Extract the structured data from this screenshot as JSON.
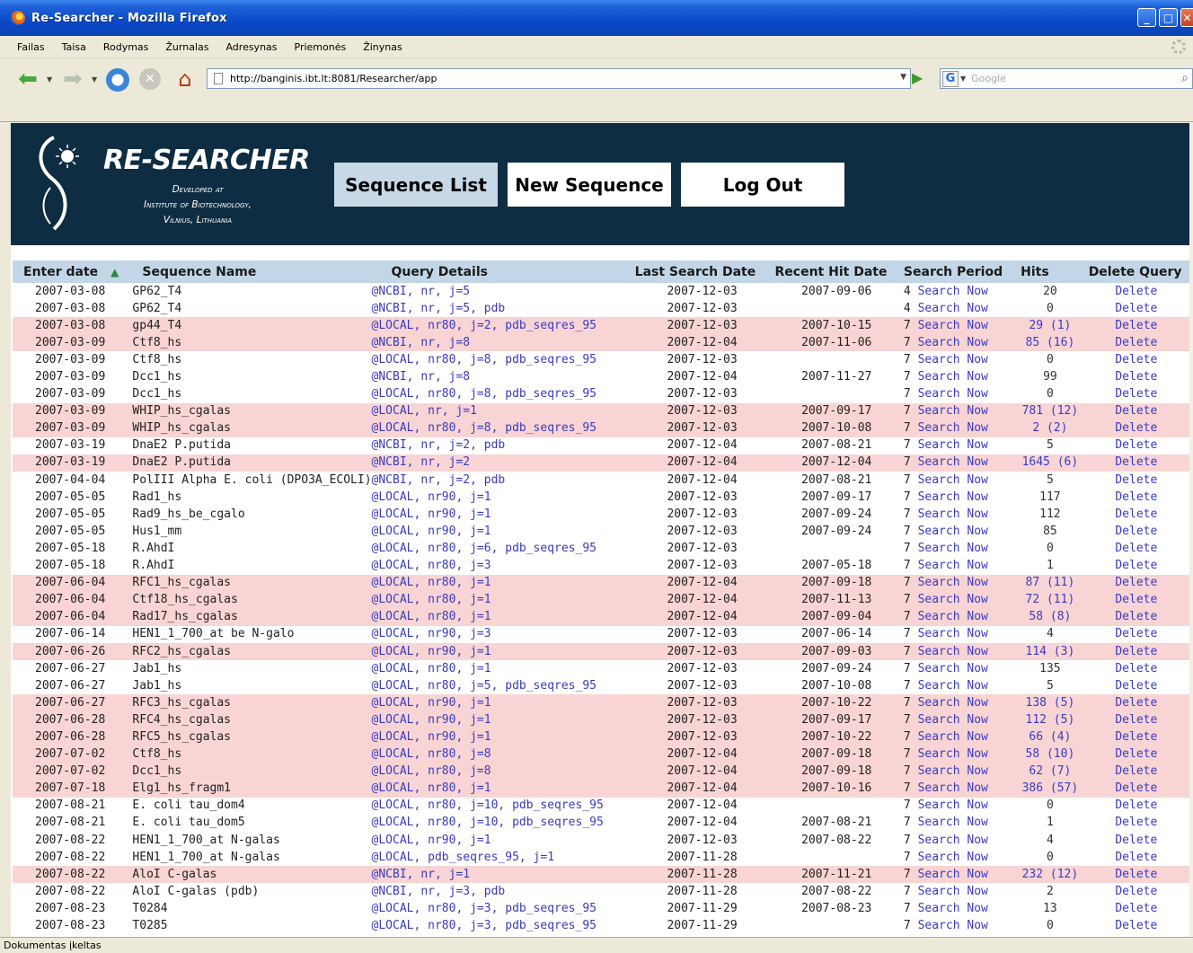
{
  "window": {
    "title": "Re-Searcher - Mozilla Firefox"
  },
  "menu": [
    "Failas",
    "Taisa",
    "Rodymas",
    "Žurnalas",
    "Adresynas",
    "Priemonės",
    "Žinynas"
  ],
  "url": "http://banginis.ibt.lt:8081/Researcher/app",
  "search": {
    "placeholder": "Google"
  },
  "app": {
    "brand": "RE-SEARCHER",
    "sub_line1": "Developed at",
    "sub_line2": "Institute of Biotechnology,",
    "sub_line3": "Vilnius, Lithuania",
    "nav": {
      "sequence_list": "Sequence List",
      "new_sequence": "New Sequence",
      "log_out": "Log Out"
    }
  },
  "table": {
    "headers": {
      "enter_date": "Enter date",
      "sequence_name": "Sequence Name",
      "query_details": "Query Details",
      "last_search": "Last Search Date",
      "recent_hit": "Recent Hit Date",
      "search_period": "Search Period",
      "hits": "Hits",
      "delete": "Delete Query"
    },
    "rows": [
      {
        "d": "2007-03-08",
        "n": "GP62_T4",
        "q": "@NCBI, nr, j=5",
        "ls": "2007-12-03",
        "rh": "2007-09-06",
        "p": "4",
        "h": "20",
        "hl": false
      },
      {
        "d": "2007-03-08",
        "n": "GP62_T4",
        "q": "@NCBI, nr, j=5, pdb",
        "ls": "2007-12-03",
        "rh": "",
        "p": "4",
        "h": "0",
        "hl": false
      },
      {
        "d": "2007-03-08",
        "n": "gp44_T4",
        "q": "@LOCAL, nr80, j=2, pdb_seqres_95",
        "ls": "2007-12-03",
        "rh": "2007-10-15",
        "p": "7",
        "h": "29 (1)",
        "hl": true
      },
      {
        "d": "2007-03-09",
        "n": "Ctf8_hs",
        "q": "@NCBI, nr, j=8",
        "ls": "2007-12-04",
        "rh": "2007-11-06",
        "p": "7",
        "h": "85 (16)",
        "hl": true
      },
      {
        "d": "2007-03-09",
        "n": "Ctf8_hs",
        "q": "@LOCAL, nr80, j=8, pdb_seqres_95",
        "ls": "2007-12-03",
        "rh": "",
        "p": "7",
        "h": "0",
        "hl": false
      },
      {
        "d": "2007-03-09",
        "n": "Dcc1_hs",
        "q": "@NCBI, nr, j=8",
        "ls": "2007-12-04",
        "rh": "2007-11-27",
        "p": "7",
        "h": "99",
        "hl": false
      },
      {
        "d": "2007-03-09",
        "n": "Dcc1_hs",
        "q": "@LOCAL, nr80, j=8, pdb_seqres_95",
        "ls": "2007-12-03",
        "rh": "",
        "p": "7",
        "h": "0",
        "hl": false
      },
      {
        "d": "2007-03-09",
        "n": "WHIP_hs_cgalas",
        "q": "@LOCAL, nr, j=1",
        "ls": "2007-12-03",
        "rh": "2007-09-17",
        "p": "7",
        "h": "781 (12)",
        "hl": true
      },
      {
        "d": "2007-03-09",
        "n": "WHIP_hs_cgalas",
        "q": "@LOCAL, nr80, j=8, pdb_seqres_95",
        "ls": "2007-12-03",
        "rh": "2007-10-08",
        "p": "7",
        "h": "2 (2)",
        "hl": true
      },
      {
        "d": "2007-03-19",
        "n": "DnaE2 P.putida",
        "q": "@NCBI, nr, j=2, pdb",
        "ls": "2007-12-04",
        "rh": "2007-08-21",
        "p": "7",
        "h": "5",
        "hl": false
      },
      {
        "d": "2007-03-19",
        "n": "DnaE2 P.putida",
        "q": "@NCBI, nr, j=2",
        "ls": "2007-12-04",
        "rh": "2007-12-04",
        "p": "7",
        "h": "1645 (6)",
        "hl": true
      },
      {
        "d": "2007-04-04",
        "n": "PolIII Alpha E. coli (DPO3A_ECOLI)",
        "q": "@NCBI, nr, j=2, pdb",
        "ls": "2007-12-04",
        "rh": "2007-08-21",
        "p": "7",
        "h": "5",
        "hl": false
      },
      {
        "d": "2007-05-05",
        "n": "Rad1_hs",
        "q": "@LOCAL, nr90, j=1",
        "ls": "2007-12-03",
        "rh": "2007-09-17",
        "p": "7",
        "h": "117",
        "hl": false
      },
      {
        "d": "2007-05-05",
        "n": "Rad9_hs_be_cgalo",
        "q": "@LOCAL, nr90, j=1",
        "ls": "2007-12-03",
        "rh": "2007-09-24",
        "p": "7",
        "h": "112",
        "hl": false
      },
      {
        "d": "2007-05-05",
        "n": "Hus1_mm",
        "q": "@LOCAL, nr90, j=1",
        "ls": "2007-12-03",
        "rh": "2007-09-24",
        "p": "7",
        "h": "85",
        "hl": false
      },
      {
        "d": "2007-05-18",
        "n": "R.AhdI",
        "q": "@LOCAL, nr80, j=6, pdb_seqres_95",
        "ls": "2007-12-03",
        "rh": "",
        "p": "7",
        "h": "0",
        "hl": false
      },
      {
        "d": "2007-05-18",
        "n": "R.AhdI",
        "q": "@LOCAL, nr80, j=3",
        "ls": "2007-12-03",
        "rh": "2007-05-18",
        "p": "7",
        "h": "1",
        "hl": false
      },
      {
        "d": "2007-06-04",
        "n": "RFC1_hs_cgalas",
        "q": "@LOCAL, nr80, j=1",
        "ls": "2007-12-04",
        "rh": "2007-09-18",
        "p": "7",
        "h": "87 (11)",
        "hl": true
      },
      {
        "d": "2007-06-04",
        "n": "Ctf18_hs_cgalas",
        "q": "@LOCAL, nr80, j=1",
        "ls": "2007-12-04",
        "rh": "2007-11-13",
        "p": "7",
        "h": "72 (11)",
        "hl": true
      },
      {
        "d": "2007-06-04",
        "n": "Rad17_hs_cgalas",
        "q": "@LOCAL, nr80, j=1",
        "ls": "2007-12-04",
        "rh": "2007-09-04",
        "p": "7",
        "h": "58 (8)",
        "hl": true
      },
      {
        "d": "2007-06-14",
        "n": "HEN1_1_700_at be N-galo",
        "q": "@LOCAL, nr90, j=3",
        "ls": "2007-12-03",
        "rh": "2007-06-14",
        "p": "7",
        "h": "4",
        "hl": false
      },
      {
        "d": "2007-06-26",
        "n": "RFC2_hs_cgalas",
        "q": "@LOCAL, nr90, j=1",
        "ls": "2007-12-03",
        "rh": "2007-09-03",
        "p": "7",
        "h": "114 (3)",
        "hl": true
      },
      {
        "d": "2007-06-27",
        "n": "Jab1_hs",
        "q": "@LOCAL, nr80, j=1",
        "ls": "2007-12-03",
        "rh": "2007-09-24",
        "p": "7",
        "h": "135",
        "hl": false
      },
      {
        "d": "2007-06-27",
        "n": "Jab1_hs",
        "q": "@LOCAL, nr80, j=5, pdb_seqres_95",
        "ls": "2007-12-03",
        "rh": "2007-10-08",
        "p": "7",
        "h": "5",
        "hl": false
      },
      {
        "d": "2007-06-27",
        "n": "RFC3_hs_cgalas",
        "q": "@LOCAL, nr90, j=1",
        "ls": "2007-12-03",
        "rh": "2007-10-22",
        "p": "7",
        "h": "138 (5)",
        "hl": true
      },
      {
        "d": "2007-06-28",
        "n": "RFC4_hs_cgalas",
        "q": "@LOCAL, nr90, j=1",
        "ls": "2007-12-03",
        "rh": "2007-09-17",
        "p": "7",
        "h": "112 (5)",
        "hl": true
      },
      {
        "d": "2007-06-28",
        "n": "RFC5_hs_cgalas",
        "q": "@LOCAL, nr90, j=1",
        "ls": "2007-12-03",
        "rh": "2007-10-22",
        "p": "7",
        "h": "66 (4)",
        "hl": true
      },
      {
        "d": "2007-07-02",
        "n": "Ctf8_hs",
        "q": "@LOCAL, nr80, j=8",
        "ls": "2007-12-04",
        "rh": "2007-09-18",
        "p": "7",
        "h": "58 (10)",
        "hl": true
      },
      {
        "d": "2007-07-02",
        "n": "Dcc1_hs",
        "q": "@LOCAL, nr80, j=8",
        "ls": "2007-12-04",
        "rh": "2007-09-18",
        "p": "7",
        "h": "62 (7)",
        "hl": true
      },
      {
        "d": "2007-07-18",
        "n": "Elg1_hs_fragm1",
        "q": "@LOCAL, nr80, j=1",
        "ls": "2007-12-04",
        "rh": "2007-10-16",
        "p": "7",
        "h": "386 (57)",
        "hl": true
      },
      {
        "d": "2007-08-21",
        "n": "E. coli tau_dom4",
        "q": "@LOCAL, nr80, j=10, pdb_seqres_95",
        "ls": "2007-12-04",
        "rh": "",
        "p": "7",
        "h": "0",
        "hl": false
      },
      {
        "d": "2007-08-21",
        "n": "E. coli tau_dom5",
        "q": "@LOCAL, nr80, j=10, pdb_seqres_95",
        "ls": "2007-12-04",
        "rh": "2007-08-21",
        "p": "7",
        "h": "1",
        "hl": false
      },
      {
        "d": "2007-08-22",
        "n": "HEN1_1_700_at N-galas",
        "q": "@LOCAL, nr90, j=1",
        "ls": "2007-12-03",
        "rh": "2007-08-22",
        "p": "7",
        "h": "4",
        "hl": false
      },
      {
        "d": "2007-08-22",
        "n": "HEN1_1_700_at N-galas",
        "q": "@LOCAL, pdb_seqres_95, j=1",
        "ls": "2007-11-28",
        "rh": "",
        "p": "7",
        "h": "0",
        "hl": false
      },
      {
        "d": "2007-08-22",
        "n": "AloI C-galas",
        "q": "@NCBI, nr, j=1",
        "ls": "2007-11-28",
        "rh": "2007-11-21",
        "p": "7",
        "h": "232 (12)",
        "hl": true
      },
      {
        "d": "2007-08-22",
        "n": "AloI C-galas (pdb)",
        "q": "@NCBI, nr, j=3, pdb",
        "ls": "2007-11-28",
        "rh": "2007-08-22",
        "p": "7",
        "h": "2",
        "hl": false
      },
      {
        "d": "2007-08-23",
        "n": "T0284",
        "q": "@LOCAL, nr80, j=3, pdb_seqres_95",
        "ls": "2007-11-29",
        "rh": "2007-08-23",
        "p": "7",
        "h": "13",
        "hl": false
      },
      {
        "d": "2007-08-23",
        "n": "T0285",
        "q": "@LOCAL, nr80, j=3, pdb_seqres_95",
        "ls": "2007-11-29",
        "rh": "",
        "p": "7",
        "h": "0",
        "hl": false
      }
    ],
    "search_now_label": "Search Now",
    "delete_label": "Delete"
  },
  "status": "Dokumentas įkeltas"
}
